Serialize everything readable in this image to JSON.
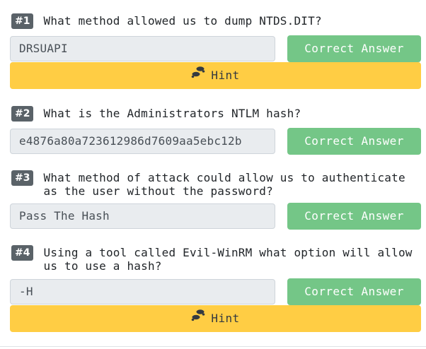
{
  "questions": [
    {
      "number": "#1",
      "text": "What method allowed us to dump NTDS.DIT?",
      "answer": "DRSUAPI",
      "button_label": "Correct Answer",
      "hint_label": "Hint"
    },
    {
      "number": "#2",
      "text": "What is the Administrators NTLM hash?",
      "answer": "e4876a80a723612986d7609aa5ebc12b",
      "button_label": "Correct Answer"
    },
    {
      "number": "#3",
      "text": "What method of attack could allow us to authenticate as the user without the password?",
      "answer": "Pass The Hash",
      "button_label": "Correct Answer"
    },
    {
      "number": "#4",
      "text": "Using a tool called Evil-WinRM what option will allow us to use a hash?",
      "answer": "-H",
      "button_label": "Correct Answer",
      "hint_label": "Hint"
    }
  ],
  "colors": {
    "badge": "#5a6268",
    "correct": "#74c687",
    "hint": "#ffcd44",
    "input_bg": "#e9ecef"
  },
  "icons": {
    "hint": "footsteps-icon"
  }
}
